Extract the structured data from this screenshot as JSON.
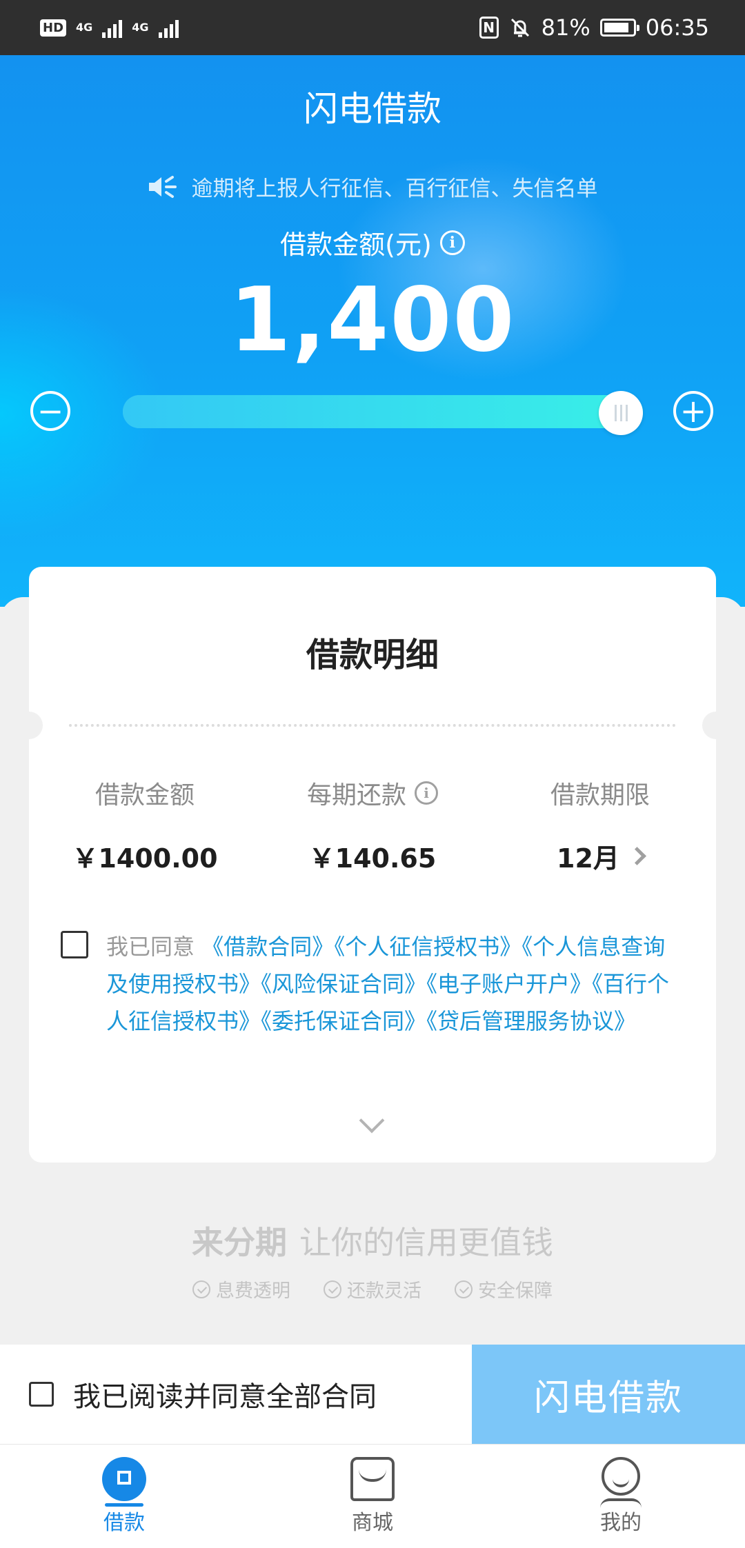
{
  "status_bar": {
    "hd": "HD",
    "net1": "4G",
    "net2": "4G",
    "nfc": "N",
    "battery_percent": "81%",
    "time": "06:35"
  },
  "header": {
    "title": "闪电借款",
    "notice": "逾期将上报人行征信、百行征信、失信名单",
    "amount_label": "借款金额(元)",
    "amount": "1,400"
  },
  "slider": {
    "minus_symbol": "−",
    "plus_symbol": "+",
    "fill_fraction": 1.0
  },
  "detail_card": {
    "title": "借款明细",
    "columns": [
      {
        "label": "借款金额",
        "value": "￥1400.00"
      },
      {
        "label": "每期还款",
        "value": "￥140.65"
      },
      {
        "label": "借款期限",
        "value": "12月"
      }
    ],
    "agree_prefix": "我已同意",
    "contracts": [
      "《借款合同》",
      "《个人征信授权书》",
      "《个人信息查询及使用授权书》",
      "《风险保证合同》",
      "《电子账户开户》",
      "《百行个人征信授权书》",
      "《委托保证合同》",
      "《贷后管理服务协议》"
    ]
  },
  "slogan": {
    "bold": "来分期",
    "rest": "让你的信用更值钱",
    "features": [
      "息费透明",
      "还款灵活",
      "安全保障"
    ]
  },
  "action_bar": {
    "agree_all": "我已阅读并同意全部合同",
    "submit": "闪电借款"
  },
  "tabs": [
    {
      "label": "借款",
      "icon": "loan-icon"
    },
    {
      "label": "商城",
      "icon": "store-icon"
    },
    {
      "label": "我的",
      "icon": "profile-icon"
    }
  ],
  "colors": {
    "primary": "#1688e6",
    "link": "#1a96d8",
    "submit_disabled": "#7cc6f8"
  }
}
